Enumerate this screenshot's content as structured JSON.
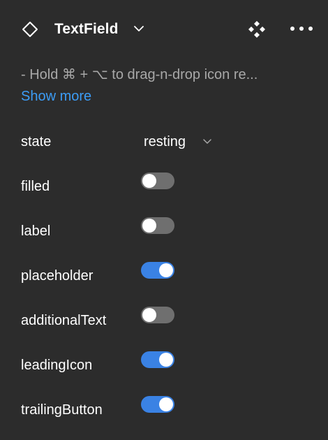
{
  "header": {
    "title": "TextField",
    "component_icon": "component-diamond-icon",
    "chevron_icon": "chevron-down-icon",
    "variant_icon": "component-variants-icon",
    "more_icon": "more-horizontal-icon"
  },
  "description": {
    "text": "- Hold ⌘ + ⌥ to drag-n-drop icon re...",
    "show_more_label": "Show more"
  },
  "properties": {
    "state": {
      "label": "state",
      "value": "resting",
      "chevron_icon": "chevron-down-icon"
    },
    "toggles": [
      {
        "label": "filled",
        "on": false
      },
      {
        "label": "label",
        "on": false
      },
      {
        "label": "placeholder",
        "on": true
      },
      {
        "label": "additionalText",
        "on": false
      },
      {
        "label": "leadingIcon",
        "on": true
      },
      {
        "label": "trailingButton",
        "on": true
      }
    ]
  },
  "colors": {
    "background": "#2c2c2c",
    "text": "#ffffff",
    "muted_text": "#a8a8a8",
    "link": "#3c9cf5",
    "toggle_on": "#3a82e4",
    "toggle_off": "#6f6f6f"
  }
}
